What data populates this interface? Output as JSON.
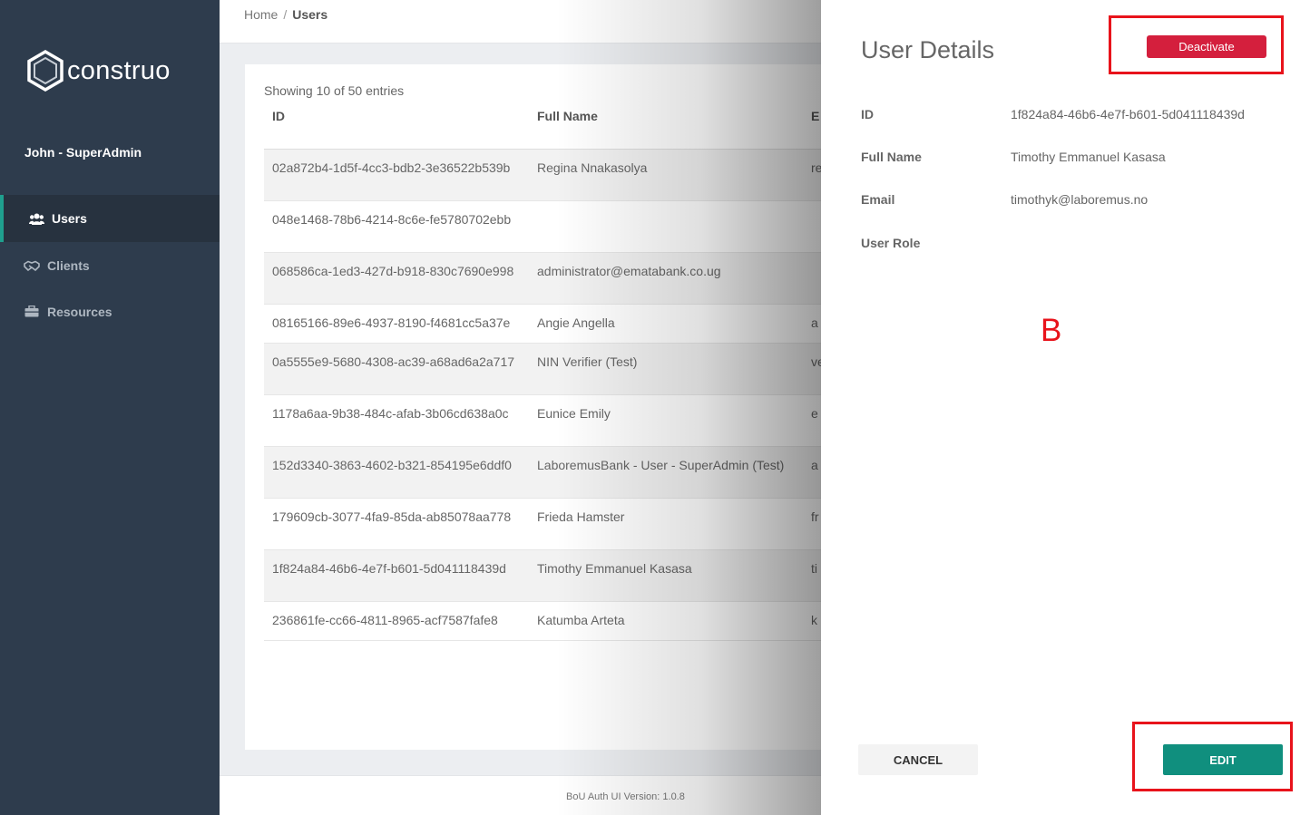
{
  "sidebar": {
    "logo_text": "construo",
    "user": "John - SuperAdmin",
    "items": [
      {
        "label": "Users",
        "icon": "users-icon"
      },
      {
        "label": "Clients",
        "icon": "handshake-icon"
      },
      {
        "label": "Resources",
        "icon": "briefcase-icon"
      }
    ]
  },
  "breadcrumb": {
    "home": "Home",
    "separator": "/",
    "current": "Users"
  },
  "table": {
    "entries_text": "Showing 10 of 50 entries",
    "columns": [
      "ID",
      "Full Name",
      "E"
    ],
    "rows": [
      {
        "id": "02a872b4-1d5f-4cc3-bdb2-3e36522b539b",
        "name": "Regina Nnakasolya",
        "email": "re"
      },
      {
        "id": "048e1468-78b6-4214-8c6e-fe5780702ebb",
        "name": "",
        "email": ""
      },
      {
        "id": "068586ca-1ed3-427d-b918-830c7690e998",
        "name": "administrator@ematabank.co.ug",
        "email": ""
      },
      {
        "id": "08165166-89e6-4937-8190-f4681cc5a37e",
        "name": "Angie Angella",
        "email": "a"
      },
      {
        "id": "0a5555e9-5680-4308-ac39-a68ad6a2a717",
        "name": "NIN Verifier (Test)",
        "email": "ve"
      },
      {
        "id": "1178a6aa-9b38-484c-afab-3b06cd638a0c",
        "name": "Eunice Emily",
        "email": "e"
      },
      {
        "id": "152d3340-3863-4602-b321-854195e6ddf0",
        "name": "LaboremusBank - User - SuperAdmin (Test)",
        "email": "a"
      },
      {
        "id": "179609cb-3077-4fa9-85da-ab85078aa778",
        "name": "Frieda Hamster",
        "email": "fr"
      },
      {
        "id": "1f824a84-46b6-4e7f-b601-5d041118439d",
        "name": "Timothy Emmanuel Kasasa",
        "email": "ti"
      },
      {
        "id": "236861fe-cc66-4811-8965-acf7587fafe8",
        "name": "Katumba Arteta",
        "email": "k"
      }
    ]
  },
  "footer": {
    "version": "BoU Auth UI Version: 1.0.8"
  },
  "drawer": {
    "title": "User Details",
    "deactivate_label": "Deactivate",
    "fields": [
      {
        "label": "ID",
        "value": "1f824a84-46b6-4e7f-b601-5d041118439d"
      },
      {
        "label": "Full Name",
        "value": "Timothy Emmanuel Kasasa"
      },
      {
        "label": "Email",
        "value": "timothyk@laboremus.no"
      },
      {
        "label": "User Role",
        "value": ""
      }
    ],
    "cancel_label": "CANCEL",
    "edit_label": "EDIT"
  },
  "annotation": {
    "label": "B"
  },
  "colors": {
    "sidebar_bg": "#2e3c4d",
    "accent": "#108f7e",
    "danger": "#d41f3d",
    "annotation": "#e8131b"
  }
}
